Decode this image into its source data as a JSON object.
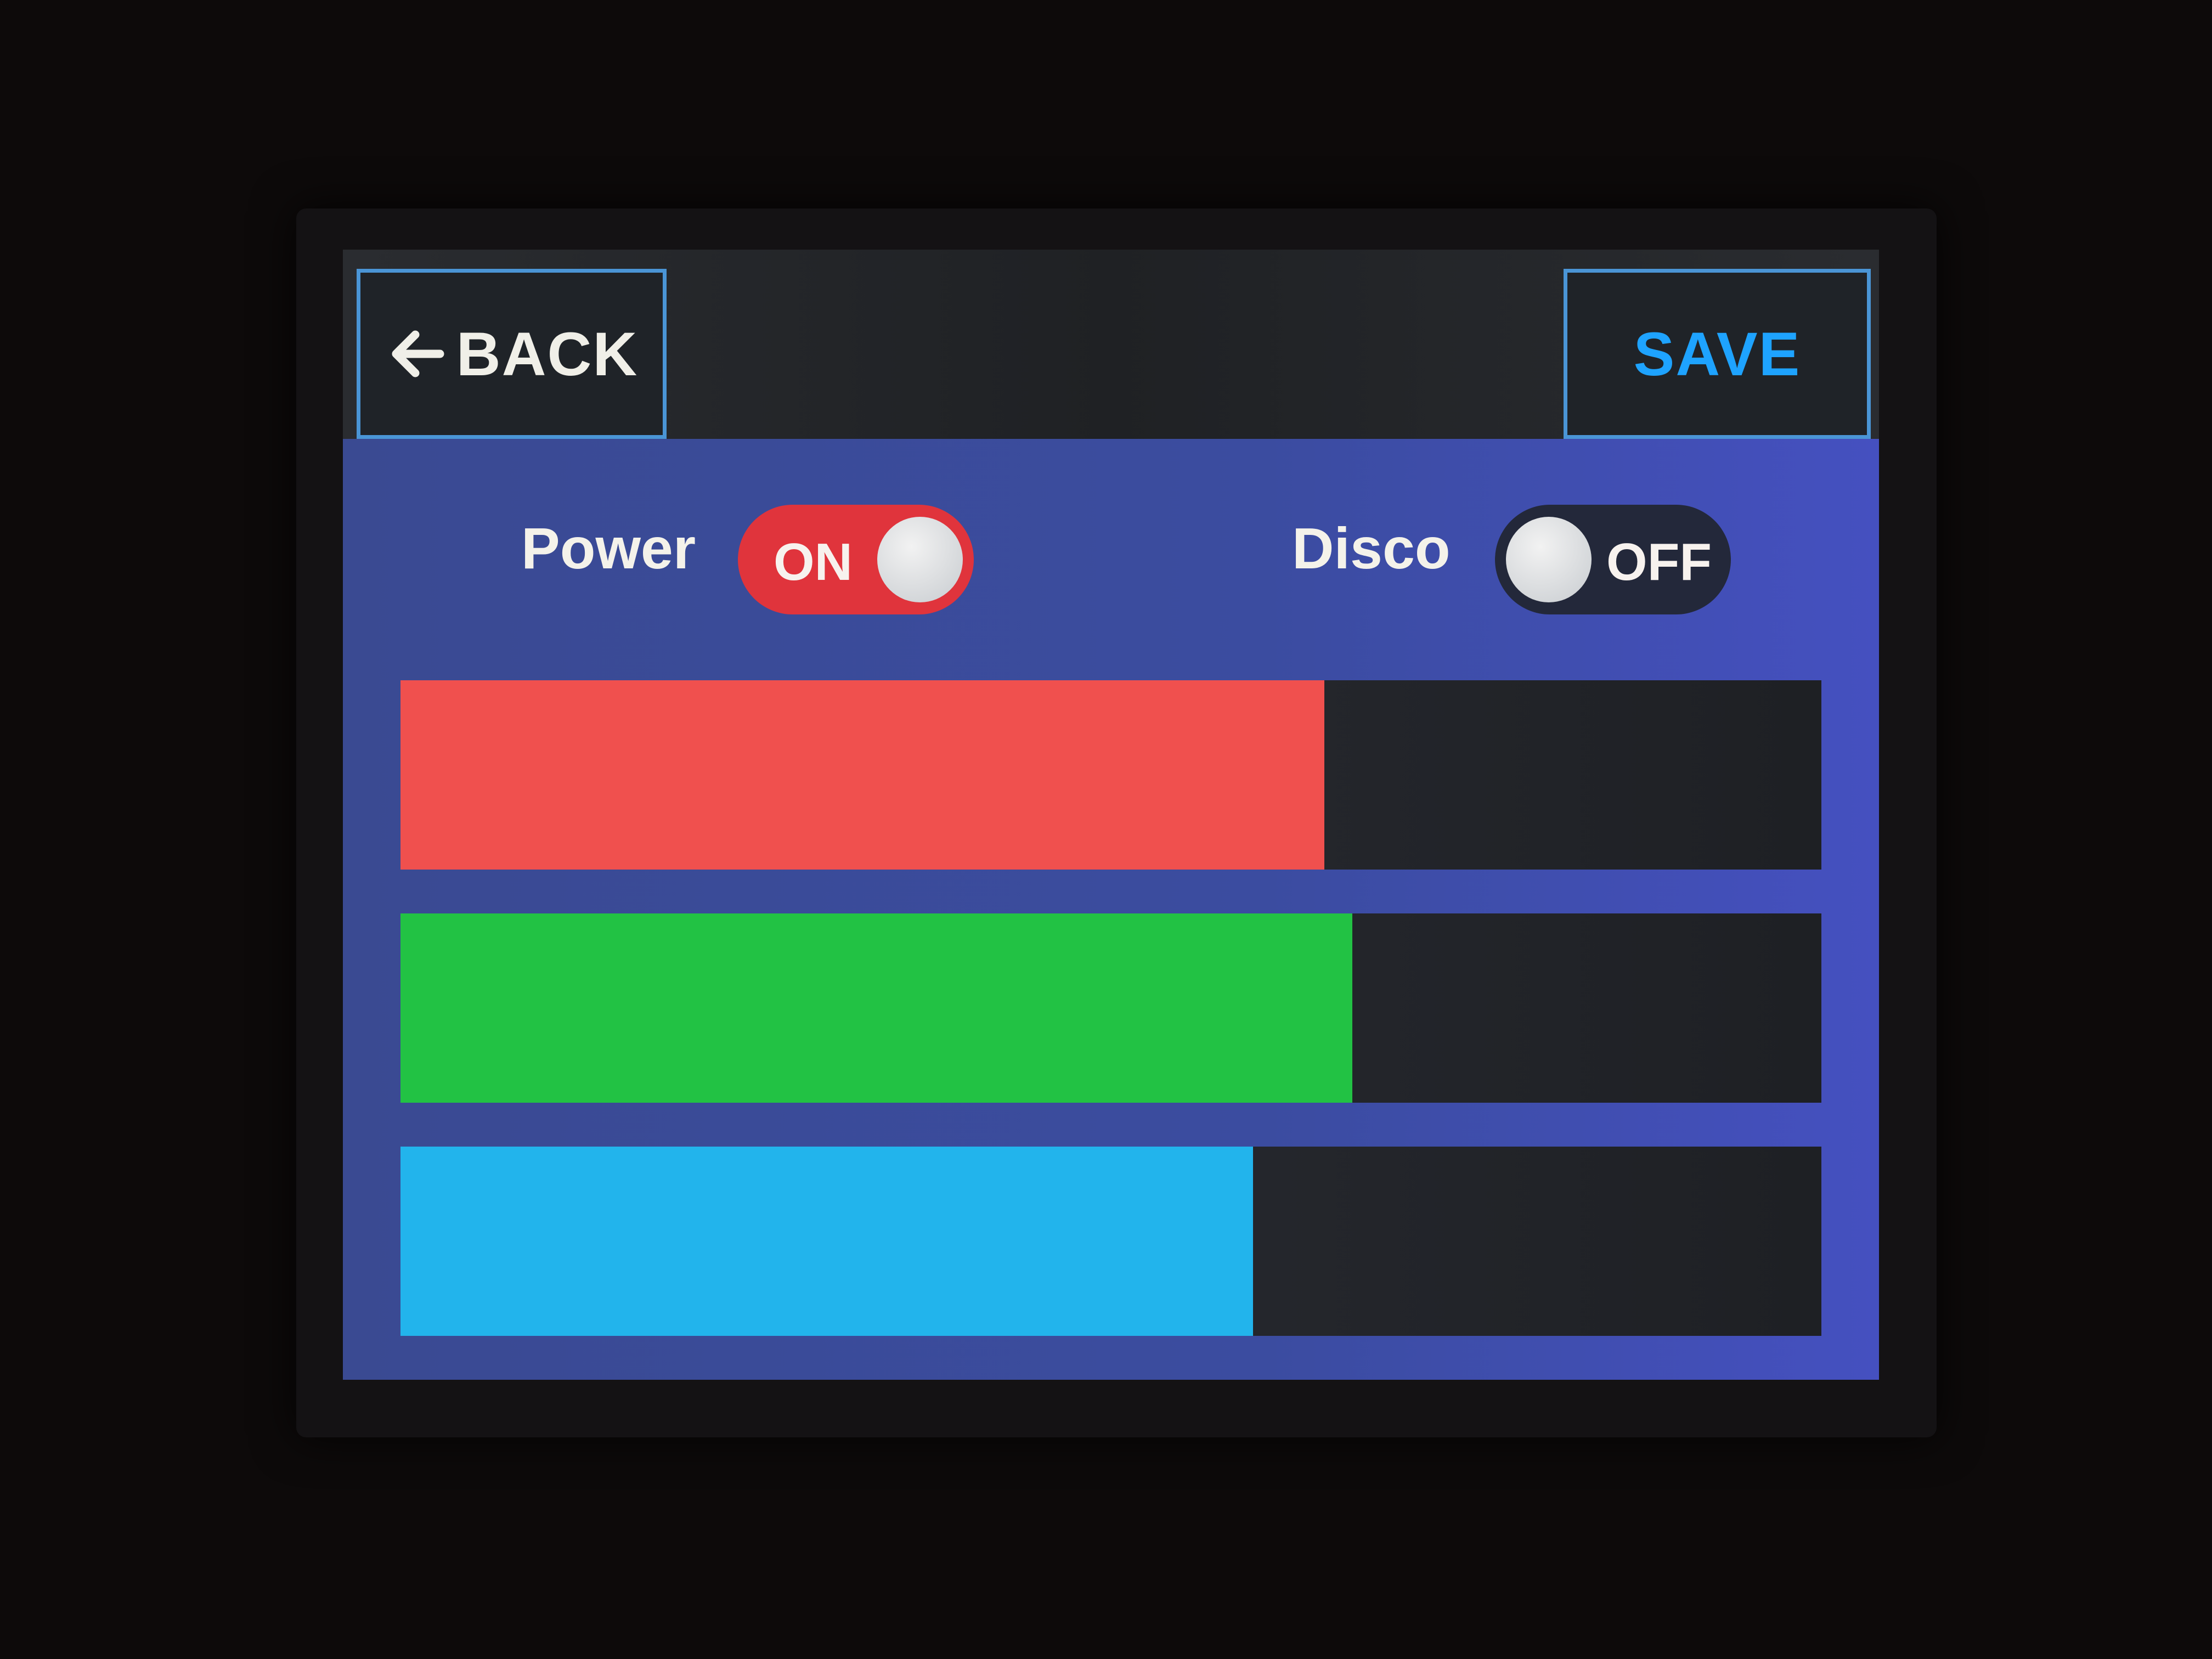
{
  "header": {
    "back_label": "BACK",
    "save_label": "SAVE"
  },
  "toggles": {
    "power": {
      "label": "Power",
      "state_text": "ON",
      "on": true
    },
    "disco": {
      "label": "Disco",
      "state_text": "OFF",
      "on": false
    }
  },
  "sliders": [
    {
      "name": "red",
      "color": "#f0504e",
      "level": 0.65
    },
    {
      "name": "green",
      "color": "#22c244",
      "level": 0.67
    },
    {
      "name": "blue",
      "color": "#22b4ec",
      "level": 0.6
    }
  ],
  "colors": {
    "accent": "#1ea3ff",
    "panel": "#3b4ca0",
    "toggle_on": "#e0343c",
    "toggle_off": "#23283a"
  },
  "icons": {
    "back": "arrow-left-icon"
  }
}
